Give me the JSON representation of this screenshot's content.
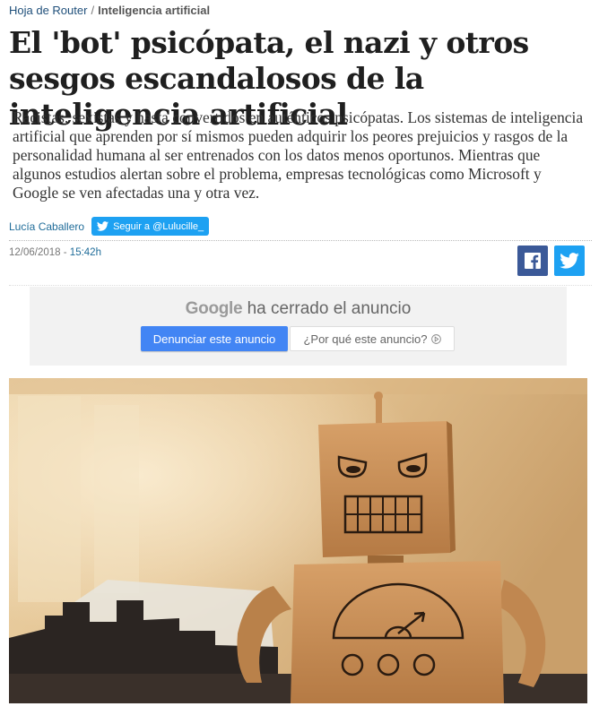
{
  "breadcrumb": {
    "section": "Hoja de Router",
    "separator": "/",
    "current": "Inteligencia artificial"
  },
  "article": {
    "title": "El 'bot' psicópata, el nazi y otros sesgos escandalosos de la inteligencia artificial",
    "lead": "Racistas, sexistas y hasta convertidos en auténticos psicópatas. Los sistemas de inteligencia artificial que aprenden por sí mismos pueden adquirir los peores prejuicios y rasgos de la personalidad humana al ser entrenados con los datos menos oportunos. Mientras que algunos estudios alertan sobre el problema, empresas tecnológicas como Microsoft y Google se ven afectadas una y otra vez.",
    "author": "Lucía Caballero",
    "follow_label": "Seguir a @Lulucille_",
    "date": "12/06/2018 -",
    "time": "15:42h"
  },
  "share": {
    "facebook_icon": "facebook-icon",
    "twitter_icon": "twitter-icon",
    "facebook_color": "#3b5998",
    "twitter_color": "#1da1f2"
  },
  "ad": {
    "brand": "Google",
    "closed_text": "ha cerrado el anuncio",
    "report_button": "Denunciar este anuncio",
    "why_button": "¿Por qué este anuncio?",
    "why_icon": "ad-info-triangle-icon",
    "report_color": "#4285f4"
  },
  "hero_image": {
    "icon": "cardboard-robot-photo"
  }
}
